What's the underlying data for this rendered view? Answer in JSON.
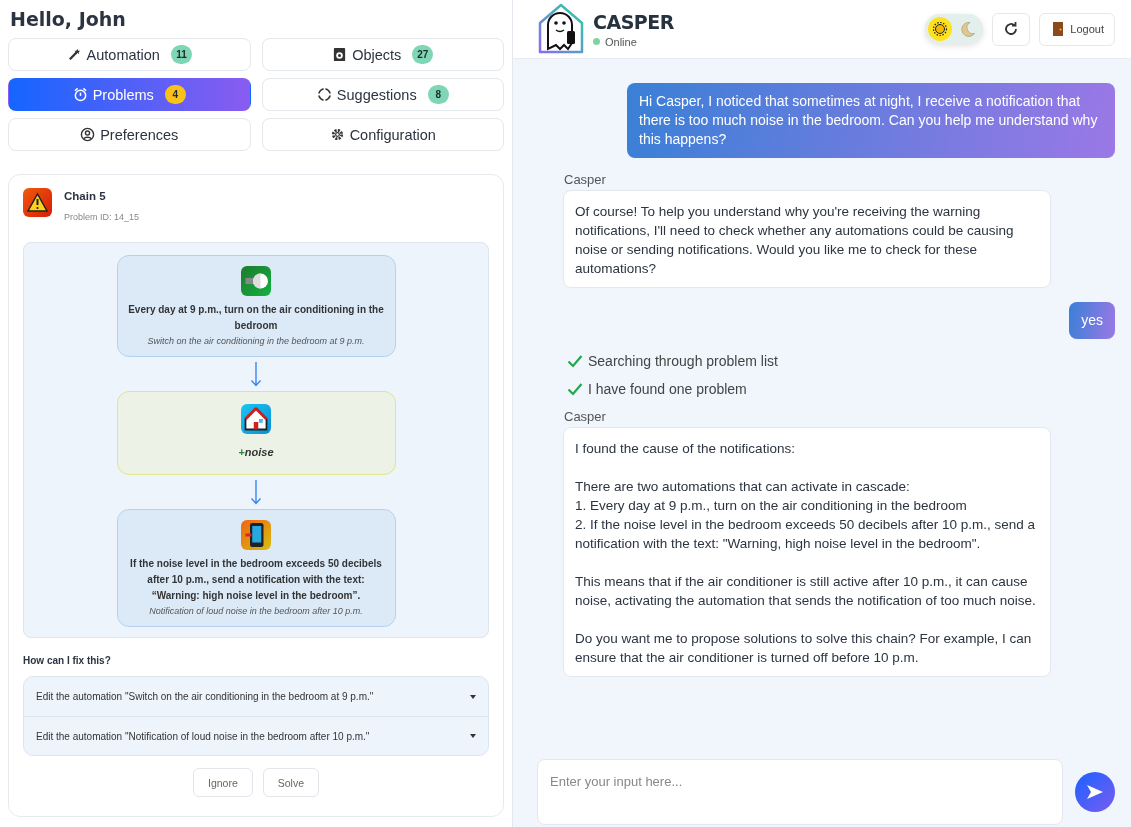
{
  "greeting": "Hello, John",
  "nav": [
    {
      "label": "Automation",
      "count": "11",
      "selected": false
    },
    {
      "label": "Objects",
      "count": "27",
      "selected": false
    },
    {
      "label": "Problems",
      "count": "4",
      "selected": true
    },
    {
      "label": "Suggestions",
      "count": "8",
      "selected": false
    },
    {
      "label": "Preferences",
      "selected": false
    },
    {
      "label": "Configuration",
      "selected": false
    }
  ],
  "problem": {
    "title": "Chain 5",
    "id_text": "Problem ID: 14_15",
    "chain": [
      {
        "kind": "automation",
        "text": "Every day at 9 p.m., turn on the air conditioning in the bedroom",
        "subtitle": "Switch on the air conditioning in the bedroom at 9 p.m."
      },
      {
        "kind": "state",
        "sign": "+",
        "text": "noise"
      },
      {
        "kind": "automation",
        "text": "If the noise level in the bedroom exceeds 50 decibels after 10 p.m., send a notification with the text: “Warning: high noise level in the bedroom”.",
        "subtitle": "Notification of loud noise in the bedroom after 10 p.m."
      }
    ],
    "fix_title": "How can I fix this?",
    "fixes": [
      {
        "text": "Edit the automation \"Switch on the air conditioning in the bedroom at 9 p.m.\"",
        "expanded": false
      },
      {
        "text": "Edit the automation \"Notification of loud noise in the bedroom after 10 p.m.\"",
        "expanded": false
      }
    ],
    "buttons": [
      "Ignore",
      "Solve"
    ]
  },
  "header": {
    "name": "CASPER",
    "status": "Online",
    "online": true,
    "theme_options": [
      {
        "kind": "sun",
        "selected": true
      },
      {
        "kind": "moon",
        "selected": false
      }
    ],
    "logout": "Logout"
  },
  "messages": [
    {
      "kind": "user",
      "text": "Hi Casper, I noticed that sometimes at night, I receive a notification that there is too much noise in the bedroom. Can you help me understand why this happens?"
    },
    {
      "kind": "bot",
      "sender": "Casper",
      "text": "Of course! To help you understand why you're receiving the warning notifications, I'll need to check whether any automations could be causing noise or sending notifications. Would you like me to check for these automations?"
    },
    {
      "kind": "user",
      "text": "yes"
    },
    {
      "kind": "step",
      "text": "Searching through problem list",
      "done": true
    },
    {
      "kind": "step",
      "text": "I have found one problem",
      "done": true
    },
    {
      "kind": "bot",
      "sender": "Casper",
      "text": "I found the cause of the notifications:\n\nThere are two automations that can activate in cascade:\n1. Every day at 9 p.m., turn on the air conditioning in the bedroom\n2. If the noise level in the bedroom exceeds 50 decibels after 10 p.m., send a notification with the text: \"Warning, high noise level in the bedroom\".\n\nThis means that if the air conditioner is still active after 10 p.m., it can cause noise, activating the automation that sends the notification of too much noise.\n\nDo you want me to propose solutions to solve this chain? For example, I can ensure that the air conditioner is turned off before 10 p.m."
    }
  ],
  "input": {
    "placeholder": "Enter your input here..."
  }
}
